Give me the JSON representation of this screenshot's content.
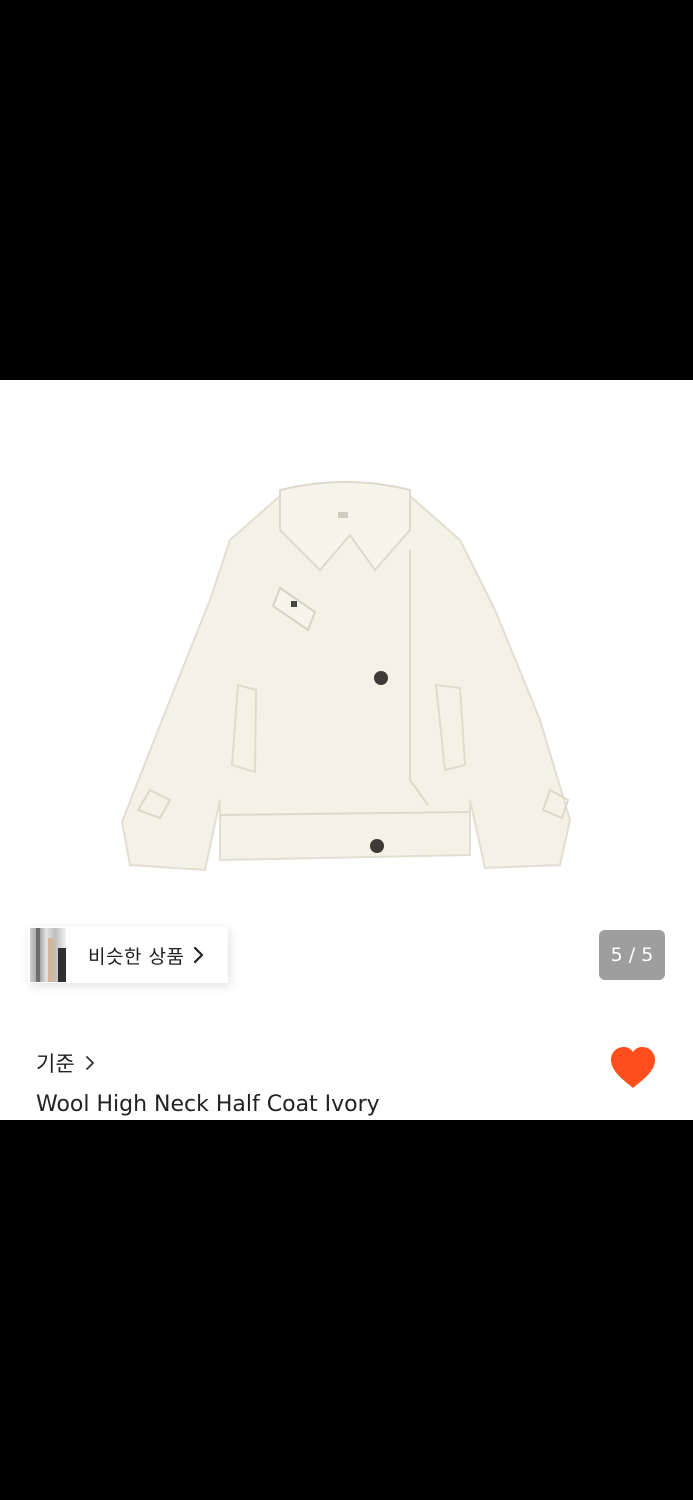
{
  "similar_products": {
    "label": "비슷한 상품"
  },
  "gallery": {
    "counter": "5 / 5",
    "image_icon": "coat-image"
  },
  "product": {
    "brand": "기준",
    "title": "Wool High Neck Half Coat Ivory",
    "liked": true
  },
  "colors": {
    "like": "#FF4E1B",
    "counter_bg": "#8E8E8E",
    "coat": "#F4F1E7"
  }
}
